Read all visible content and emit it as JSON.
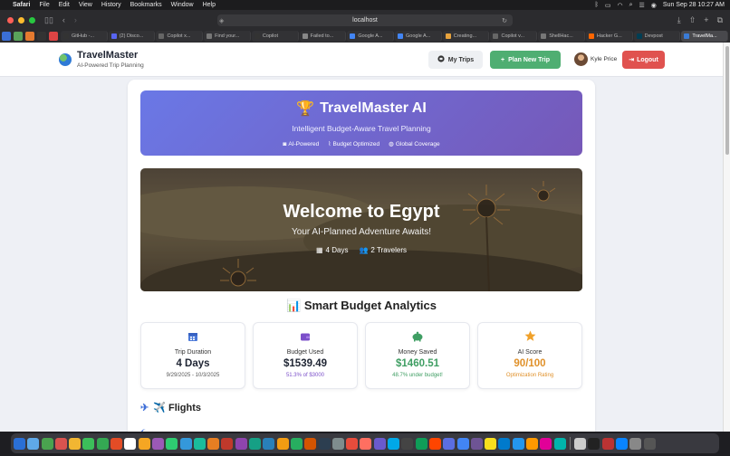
{
  "menubar": {
    "app": "Safari",
    "items": [
      "File",
      "Edit",
      "View",
      "History",
      "Bookmarks",
      "Window",
      "Help"
    ],
    "datetime": "Sun Sep 28  10:27 AM"
  },
  "browser": {
    "url": "localhost",
    "tabs": [
      {
        "label": "GitHub -...",
        "color": "#333333"
      },
      {
        "label": "(2) Disco...",
        "color": "#5865f2"
      },
      {
        "label": "Copilot x...",
        "color": "#666666"
      },
      {
        "label": "Find your...",
        "color": "#777777"
      },
      {
        "label": "Copilot",
        "color": "#333333"
      },
      {
        "label": "Failed to...",
        "color": "#888888"
      },
      {
        "label": "Google A...",
        "color": "#4285f4"
      },
      {
        "label": "Google A...",
        "color": "#4285f4"
      },
      {
        "label": "Creating...",
        "color": "#e8a33d"
      },
      {
        "label": "Copilot v...",
        "color": "#666666"
      },
      {
        "label": "ShellHac...",
        "color": "#777777"
      },
      {
        "label": "Hacker G...",
        "color": "#ff6600"
      },
      {
        "label": "Devpost",
        "color": "#003e54"
      },
      {
        "label": "TravelMa...",
        "color": "#3a7bd5",
        "active": true
      }
    ]
  },
  "navbar": {
    "brand_title": "TravelMaster",
    "brand_subtitle": "AI-Powered Trip Planning",
    "my_trips": "My Trips",
    "plan_new_trip": "Plan New Trip",
    "user_name": "Kyle Price",
    "logout": "Logout"
  },
  "hero": {
    "emoji": "🏆",
    "title": "TravelMaster AI",
    "subtitle": "Intelligent Budget-Aware Travel Planning",
    "badges": [
      "AI-Powered",
      "Budget Optimized",
      "Global Coverage"
    ]
  },
  "banner": {
    "title": "Welcome to Egypt",
    "subtitle": "Your AI-Planned Adventure Awaits!",
    "days": "4 Days",
    "travelers": "2 Travelers"
  },
  "analytics": {
    "title": "📊 Smart Budget Analytics",
    "cards": [
      {
        "label": "Trip Duration",
        "value": "4 Days",
        "note": "9/29/2025 - 10/3/2025",
        "icon": "calendar-icon",
        "icon_color": "#4a78d8",
        "value_color": "#1f2533",
        "note_color": "#555555"
      },
      {
        "label": "Budget Used",
        "value": "$1539.49",
        "note": "51.3% of $3000",
        "icon": "wallet-icon",
        "icon_color": "#7b4fc9",
        "value_color": "#1f2533",
        "note_color": "#7b4fc9"
      },
      {
        "label": "Money Saved",
        "value": "$1460.51",
        "note": "48.7% under budget!",
        "icon": "piggy-bank-icon",
        "icon_color": "#3f9e63",
        "value_color": "#3f9e63",
        "note_color": "#3f9e63"
      },
      {
        "label": "AI Score",
        "value": "90/100",
        "note": "Optimization Rating",
        "icon": "star-icon",
        "icon_color": "#f0a12a",
        "value_color": "#e0912a",
        "note_color": "#e0912a"
      }
    ]
  },
  "flights": {
    "title": "✈️ Flights"
  }
}
